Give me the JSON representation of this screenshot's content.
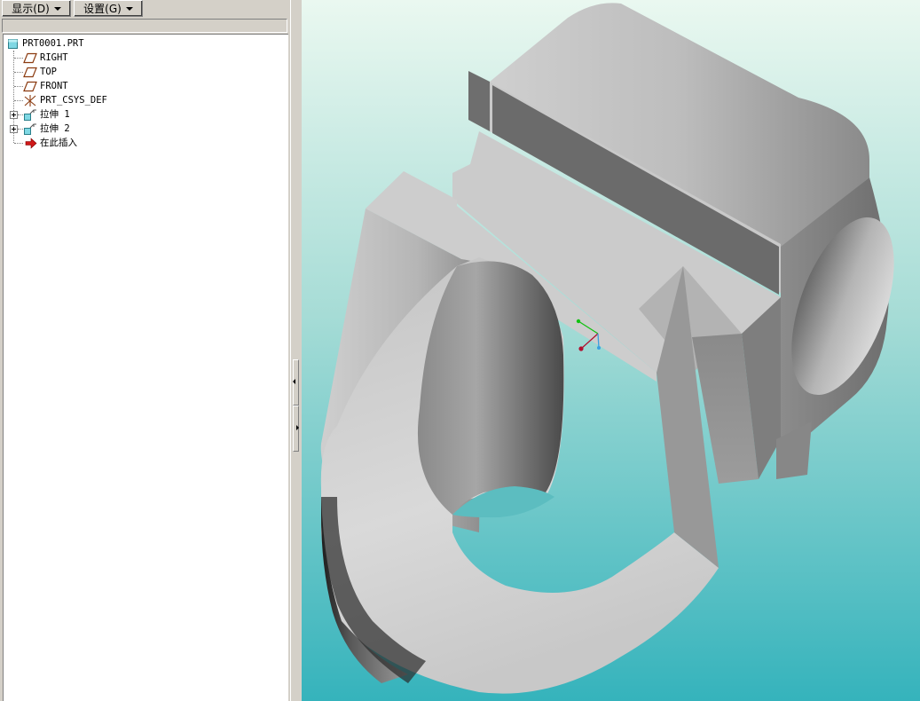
{
  "toolbar": {
    "show_label": "显示(D)",
    "settings_label": "设置(G)"
  },
  "model_tree": {
    "root": {
      "label": "PRT0001.PRT",
      "icon": "part-icon"
    },
    "items": [
      {
        "label": "RIGHT",
        "icon": "datum-plane-icon",
        "expandable": false
      },
      {
        "label": "TOP",
        "icon": "datum-plane-icon",
        "expandable": false
      },
      {
        "label": "FRONT",
        "icon": "datum-plane-icon",
        "expandable": false
      },
      {
        "label": "PRT_CSYS_DEF",
        "icon": "coordinate-system-icon",
        "expandable": false
      },
      {
        "label": "拉伸 1",
        "icon": "extrude-icon",
        "expandable": true
      },
      {
        "label": "拉伸 2",
        "icon": "extrude-icon",
        "expandable": true
      },
      {
        "label": "在此插入",
        "icon": "insert-here-arrow-icon",
        "expandable": false
      }
    ]
  },
  "viewport": {
    "background_top": "#e6f6ee",
    "background_bottom": "#39b5bd",
    "model_color": "#bcbcbc"
  }
}
